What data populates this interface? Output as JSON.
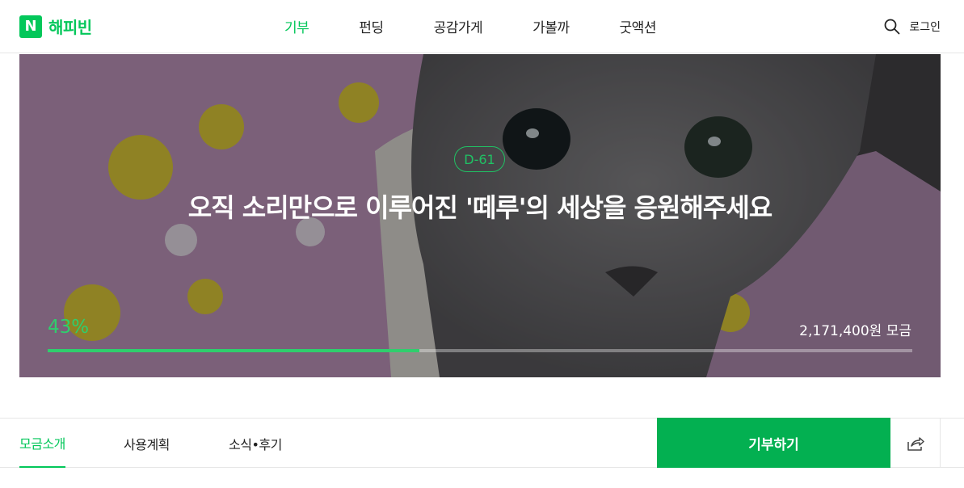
{
  "header": {
    "logo_mark": "N",
    "logo_text": "해피빈",
    "nav": [
      {
        "label": "기부",
        "active": true
      },
      {
        "label": "펀딩",
        "active": false
      },
      {
        "label": "공감가게",
        "active": false
      },
      {
        "label": "가볼까",
        "active": false
      },
      {
        "label": "굿액션",
        "active": false
      }
    ],
    "search_icon": "search-icon",
    "login_label": "로그인"
  },
  "hero": {
    "dday": "D-61",
    "title": "오직 소리만으로 이루어진 '떼루'의 세상을 응원해주세요",
    "percent_label": "43%",
    "progress": 0.43,
    "amount": "2,171,400원 모금"
  },
  "tabs": {
    "items": [
      {
        "label": "모금소개",
        "active": true
      },
      {
        "label": "사용계획",
        "active": false
      },
      {
        "label": "소식•후기",
        "active": false
      }
    ],
    "donate_label": "기부하기",
    "share_icon": "share-icon"
  },
  "colors": {
    "brand": "#03c75a",
    "donate": "#03b051",
    "progress": "#2fce6d"
  }
}
